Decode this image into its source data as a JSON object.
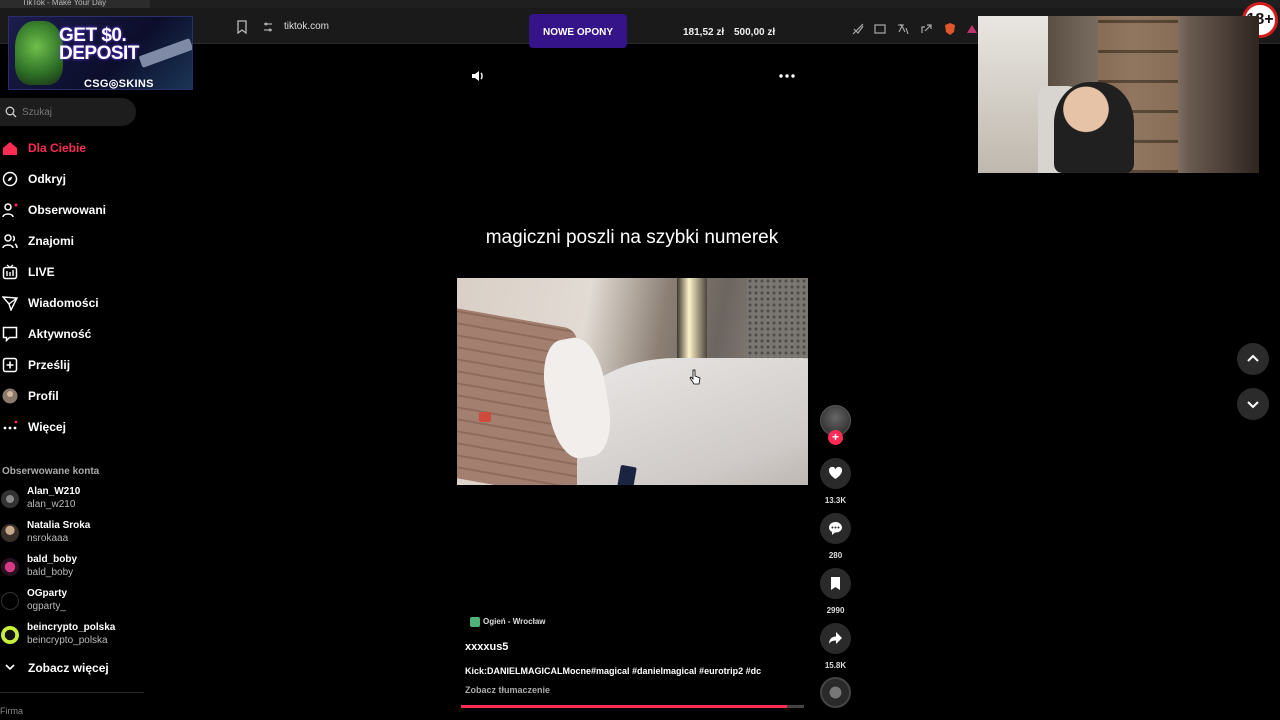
{
  "browser": {
    "tab_title": "TikTok - Make Your Day",
    "url": "tiktok.com"
  },
  "promo": {
    "label": "NOWE OPONY",
    "balance_1": "181,52 zł",
    "balance_2": "500,00 zł"
  },
  "ad": {
    "headline_1": "GET $0.",
    "headline_2": "DEPOSIT",
    "brand": "CSG◎SKINS"
  },
  "age_badge": "18+",
  "search": {
    "placeholder": "Szukaj"
  },
  "sidebar": {
    "items": [
      {
        "label": "Dla Ciebie",
        "icon": "home-icon"
      },
      {
        "label": "Odkryj",
        "icon": "compass-icon"
      },
      {
        "label": "Obserwowani",
        "icon": "following-icon"
      },
      {
        "label": "Znajomi",
        "icon": "friends-icon"
      },
      {
        "label": "LIVE",
        "icon": "live-icon"
      },
      {
        "label": "Wiadomości",
        "icon": "messages-icon"
      },
      {
        "label": "Aktywność",
        "icon": "activity-icon"
      },
      {
        "label": "Prześlij",
        "icon": "upload-icon"
      },
      {
        "label": "Profil",
        "icon": "profile-icon"
      },
      {
        "label": "Więcej",
        "icon": "more-icon"
      }
    ],
    "following_title": "Obserwowane konta",
    "accounts": [
      {
        "name": "Alan_W210",
        "handle": "alan_w210"
      },
      {
        "name": "Natalia Sroka",
        "handle": "nsrokaaa"
      },
      {
        "name": "bald_boby",
        "handle": "bald_boby"
      },
      {
        "name": "OGparty",
        "handle": "ogparty_"
      },
      {
        "name": "beincrypto_polska",
        "handle": "beincrypto_polska"
      }
    ],
    "see_more": "Zobacz więcej",
    "footer": "Firma"
  },
  "video": {
    "caption": "magiczni poszli na szybki numerek",
    "location": "Ogień - Wrocław",
    "username": "xxxxus5",
    "description": "Kick:DANIELMAGICALMocne#magical #danielmagical #eurotrip2 #dc",
    "translate": "Zobacz tłumaczenie",
    "progress": 0.95
  },
  "actions": {
    "likes": "13.3K",
    "comments": "280",
    "saves": "2990",
    "shares": "15.8K"
  },
  "colors": {
    "accent": "#fe2c55",
    "promo": "#35148a"
  }
}
